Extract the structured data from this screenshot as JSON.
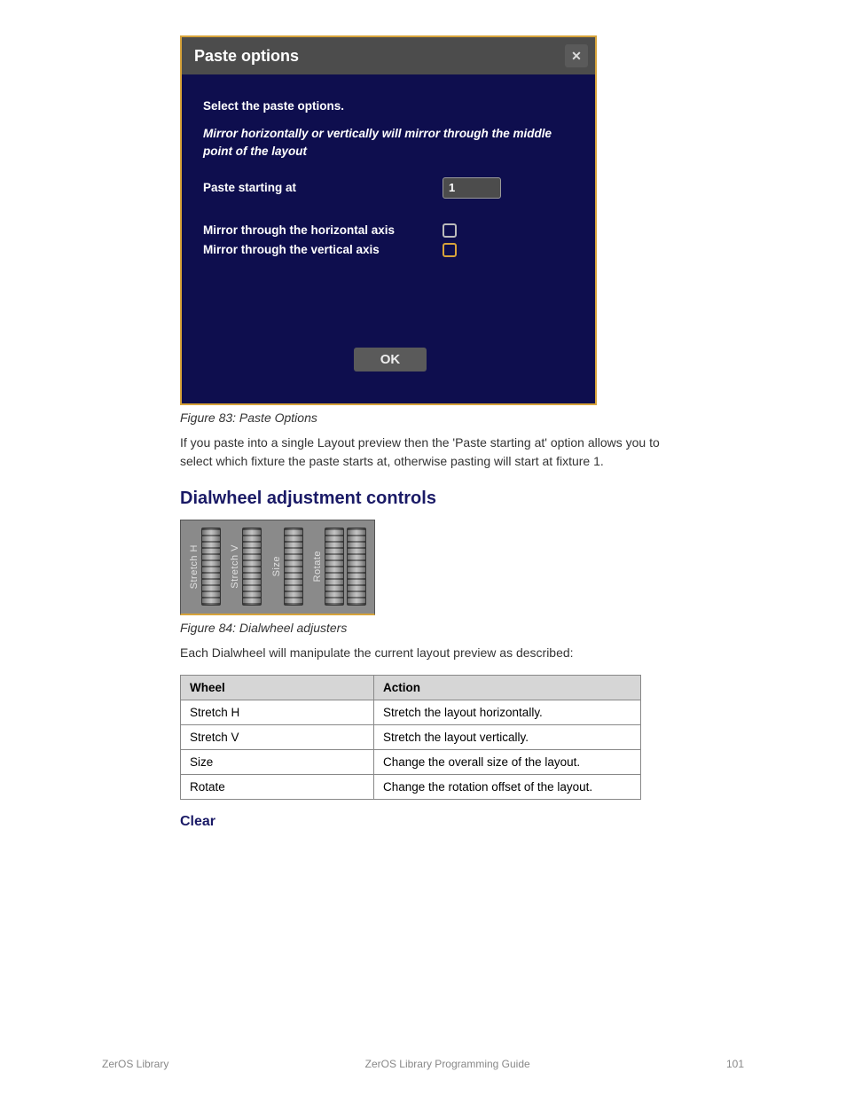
{
  "dialog": {
    "title": "Paste options",
    "instruction": "Select the paste options.",
    "help": "Mirror horizontally or vertically will mirror through the middle point of the layout",
    "pasteLabel": "Paste starting at",
    "pasteValue": "1",
    "mirrorHLabel": "Mirror through the horizontal axis",
    "mirrorVLabel": "Mirror through the vertical axis",
    "okLabel": "OK"
  },
  "captions": {
    "fig1": "Figure 83: Paste Options",
    "fig2": "Figure 84: Dialwheel adjusters"
  },
  "paragraphs": {
    "p1": "If you paste into a single Layout preview then the 'Paste starting at' option allows you to select which fixture the paste starts at, otherwise pasting will start at fixture 1.",
    "p2": "Each Dialwheel will manipulate the current layout preview as described:"
  },
  "headings": {
    "h1": "Dialwheel adjustment controls",
    "h2": "Clear"
  },
  "wheels": {
    "w1": "Stretch H",
    "w2": "Stretch V",
    "w3": "Size",
    "w4": "Rotate"
  },
  "table": {
    "head1": "Wheel",
    "head2": "Action",
    "rows": [
      {
        "c1": "Stretch H",
        "c2": "Stretch the layout horizontally."
      },
      {
        "c1": "Stretch V",
        "c2": "Stretch the layout vertically."
      },
      {
        "c1": "Size",
        "c2": "Change the overall size of the layout."
      },
      {
        "c1": "Rotate",
        "c2": "Change the rotation offset of the layout."
      }
    ]
  },
  "footer": {
    "left": "ZerOS Library",
    "center": "ZerOS Library Programming Guide",
    "right": "101"
  }
}
